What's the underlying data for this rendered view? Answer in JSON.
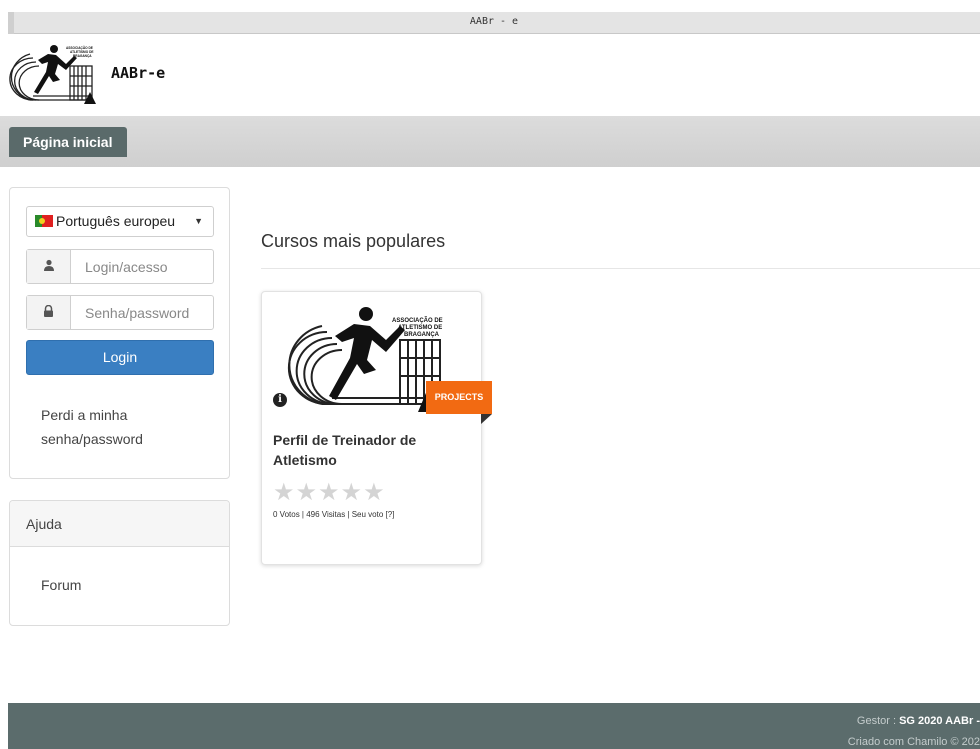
{
  "window": {
    "title": "AABr - e"
  },
  "header": {
    "site_name": "AABr-e",
    "logo_text": "ASSOCIAÇÃO DE ATLETISMO DE BRAGANÇA"
  },
  "nav": {
    "home_label": "Página inicial"
  },
  "login": {
    "language": "Português europeu",
    "username_placeholder": "Login/acesso",
    "password_placeholder": "Senha/password",
    "login_button": "Login",
    "lost_password": "Perdi a minha senha/password"
  },
  "help": {
    "title": "Ajuda",
    "forum": "Forum"
  },
  "main": {
    "section_title": "Cursos mais populares",
    "course": {
      "ribbon": "PROJECTS",
      "title": "Perfil de Treinador de Atletismo",
      "rating": 0,
      "rating_max": 5,
      "stats": "0 Votos | 496 Visitas | Seu voto [?]"
    }
  },
  "footer": {
    "manager_label": "Gestor : ",
    "manager_name": "SG 2020 AABr -",
    "created": "Criado com Chamilo © 202"
  },
  "icons": {
    "user": "user-icon",
    "lock": "lock-icon",
    "caret": "caret-down-icon",
    "info": "info-circle-icon",
    "star": "star-icon",
    "flag": "portugal-flag-icon"
  },
  "colors": {
    "navbar": "#d4d4d4",
    "nav_tab": "#5a6a6a",
    "login_button": "#3a7fc2",
    "ribbon": "#f26a12",
    "footer": "#5b6c6c"
  }
}
